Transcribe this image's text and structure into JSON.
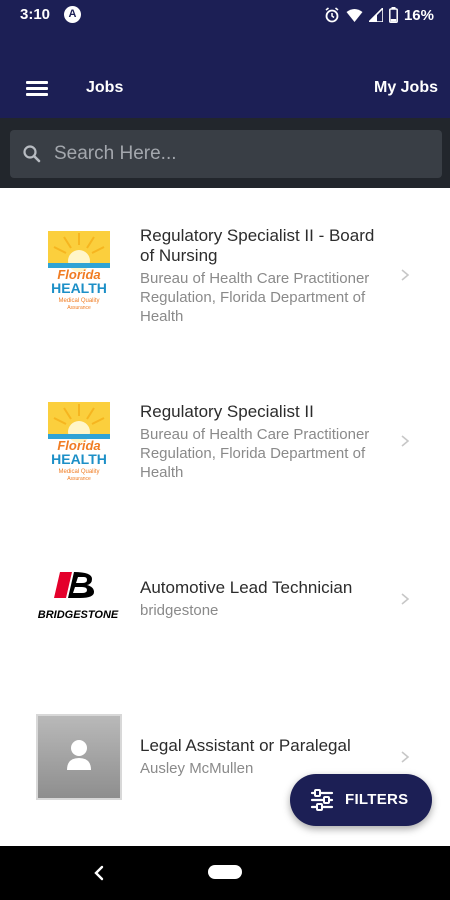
{
  "status": {
    "time": "3:10",
    "a_icon": "A",
    "battery": "16%",
    "icons": [
      "alarm-icon",
      "wifi-icon",
      "signal-icon",
      "battery-icon"
    ]
  },
  "app_bar": {
    "title": "Jobs",
    "my_jobs": "My Jobs",
    "color": "#1c1f55"
  },
  "search": {
    "placeholder": "Search Here...",
    "value": ""
  },
  "jobs": [
    {
      "logo": "florida-health-logo",
      "title": "Regulatory Specialist II - Board of Nursing",
      "company": "Bureau of Health Care Practitioner Regulation, Florida Department of Health"
    },
    {
      "logo": "florida-health-logo",
      "title": "Regulatory Specialist II",
      "company": "Bureau of Health Care Practitioner Regulation, Florida Department of Health"
    },
    {
      "logo": "bridgestone-logo",
      "title": "Automotive Lead Technician",
      "company": "bridgestone"
    },
    {
      "logo": "person-placeholder-icon",
      "title": "Legal Assistant or Paralegal",
      "company": "Ausley McMullen"
    }
  ],
  "logos": {
    "florida_line1": "Florida",
    "florida_line2": "HEALTH",
    "florida_line3": "Medical Quality",
    "florida_line4": "Assurance",
    "bridgestone": "BRIDGESTONE"
  },
  "filters_button": {
    "label": "FILTERS"
  }
}
